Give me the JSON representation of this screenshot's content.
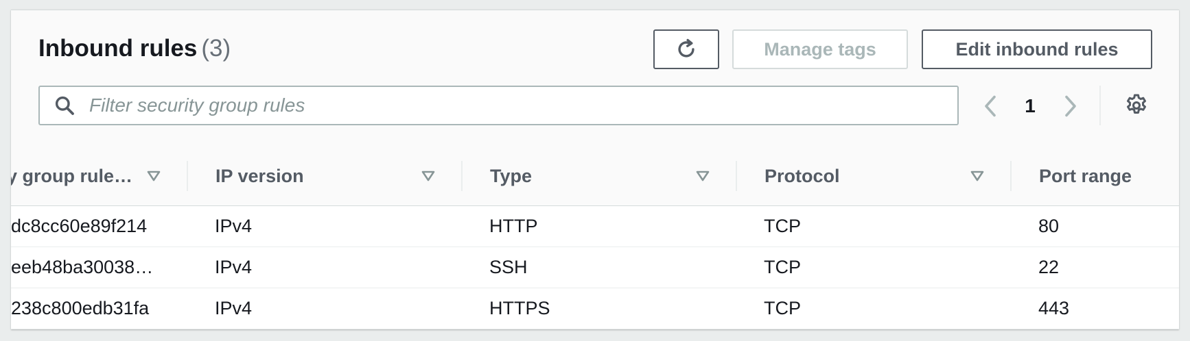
{
  "header": {
    "title": "Inbound rules",
    "count": "(3)",
    "manage_tags_label": "Manage tags",
    "edit_rules_label": "Edit inbound rules"
  },
  "search": {
    "placeholder": "Filter security group rules"
  },
  "pagination": {
    "current_page": "1"
  },
  "table": {
    "columns": [
      "y group rule…",
      "IP version",
      "Type",
      "Protocol",
      "Port range"
    ],
    "rows": [
      [
        "dc8cc60e89f214",
        "IPv4",
        "HTTP",
        "TCP",
        "80"
      ],
      [
        "eeb48ba30038…",
        "IPv4",
        "SSH",
        "TCP",
        "22"
      ],
      [
        "238c800edb31fa",
        "IPv4",
        "HTTPS",
        "TCP",
        "443"
      ]
    ]
  },
  "icons": {
    "refresh": "refresh-icon",
    "search": "search-icon",
    "prev": "chevron-left-icon",
    "next": "chevron-right-icon",
    "settings": "gear-icon",
    "sort": "sort-down-icon"
  },
  "colors": {
    "border_dark": "#545b64",
    "border_disabled": "#d5dbdb",
    "text_disabled": "#aab7b8",
    "placeholder": "#879596"
  }
}
